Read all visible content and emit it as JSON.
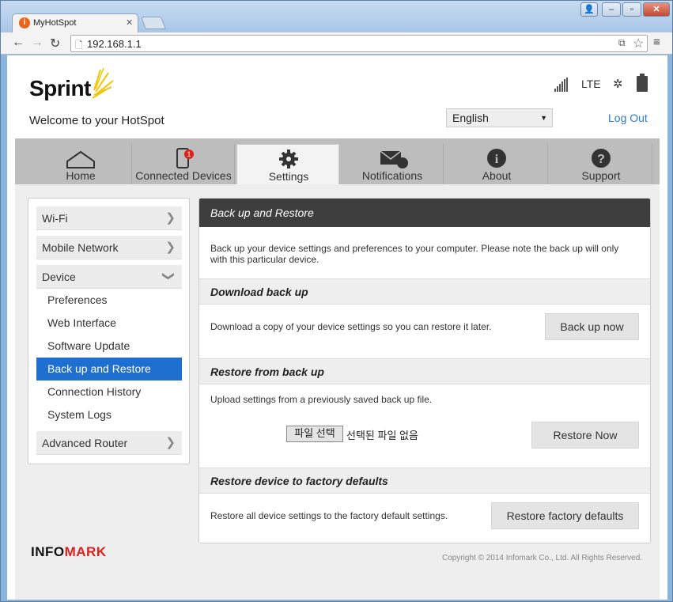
{
  "browser": {
    "tab_title": "MyHotSpot",
    "url": "192.168.1.1"
  },
  "header": {
    "brand": "Sprint",
    "welcome": "Welcome to your HotSpot",
    "network_type": "LTE",
    "language": "English",
    "logout": "Log Out"
  },
  "nav": {
    "tabs": [
      {
        "label": "Home",
        "icon": "home-icon"
      },
      {
        "label": "Connected Devices",
        "icon": "phone-icon",
        "badge": "1"
      },
      {
        "label": "Settings",
        "icon": "gear-icon"
      },
      {
        "label": "Notifications",
        "icon": "envelope-icon"
      },
      {
        "label": "About",
        "icon": "info-icon"
      },
      {
        "label": "Support",
        "icon": "question-icon"
      }
    ],
    "active": "Settings"
  },
  "sidebar": {
    "items": [
      "Wi-Fi",
      "Mobile Network",
      "Device",
      "Advanced Router"
    ],
    "device_sub": [
      "Preferences",
      "Web Interface",
      "Software Update",
      "Back up and Restore",
      "Connection History",
      "System Logs"
    ],
    "selected": "Back up and Restore"
  },
  "main": {
    "title": "Back up and Restore",
    "intro": "Back up your device settings and preferences to your computer. Please note the back up will only with this particular device.",
    "download_heading": "Download back up",
    "download_text": "Download a copy of your device settings so you can restore it later.",
    "backup_button": "Back up now",
    "restore_heading": "Restore from back up",
    "restore_text": "Upload settings from a previously saved back up file.",
    "file_button": "파일 선택",
    "no_file": "선택된 파일 없음",
    "restore_button": "Restore Now",
    "factory_heading": "Restore device to factory defaults",
    "factory_text": "Restore all device settings to the factory default settings.",
    "factory_button": "Restore factory defaults"
  },
  "footer": {
    "logo_part1": "INFO",
    "logo_part2": "MARK",
    "copyright": "Copyright © 2014 Infomark Co., Ltd. All Rights Reserved."
  },
  "colors": {
    "accent": "#1e6fd0",
    "brand_yellow": "#f2c500",
    "header_dark": "#3e3e3e",
    "infomark_red": "#e0201b"
  }
}
